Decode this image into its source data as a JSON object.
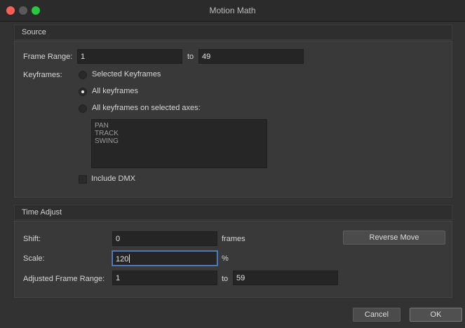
{
  "window": {
    "title": "Motion Math"
  },
  "source": {
    "header": "Source",
    "frame_range_label": "Frame Range:",
    "frame_start": "1",
    "to_label": "to",
    "frame_end": "49",
    "keyframes_label": "Keyframes:",
    "options": [
      {
        "label": "Selected Keyframes",
        "checked": false
      },
      {
        "label": "All keyframes",
        "checked": true
      },
      {
        "label": "All keyframes on selected axes:",
        "checked": false
      }
    ],
    "axes": [
      "PAN",
      "TRACK",
      "SWING"
    ],
    "include_dmx_label": "Include DMX",
    "include_dmx_checked": false
  },
  "time_adjust": {
    "header": "Time Adjust",
    "shift_label": "Shift:",
    "shift_value": "0",
    "shift_unit": "frames",
    "reverse_button": "Reverse Move",
    "scale_label": "Scale:",
    "scale_value": "120",
    "scale_unit": "%",
    "adjusted_label": "Adjusted Frame Range:",
    "adjusted_start": "1",
    "to_label": "to",
    "adjusted_end": "59"
  },
  "footer": {
    "cancel": "Cancel",
    "ok": "OK"
  }
}
